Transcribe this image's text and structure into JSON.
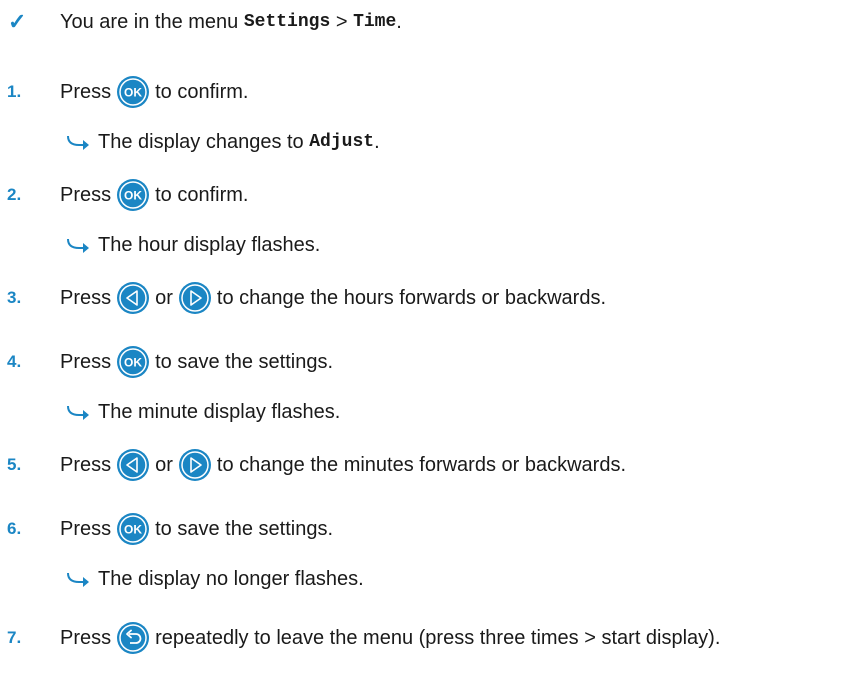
{
  "precondition": {
    "prefix": "You are in the menu ",
    "menu1": "Settings",
    "separator": " > ",
    "menu2": "Time",
    "suffix": "."
  },
  "steps": [
    {
      "num": "1.",
      "pre": "Press",
      "post": "to confirm.",
      "result_pre": "The display changes to ",
      "result_code": "Adjust",
      "result_post": "."
    },
    {
      "num": "2.",
      "pre": "Press",
      "post": "to confirm.",
      "result": "The hour display flashes."
    },
    {
      "num": "3.",
      "pre": "Press",
      "mid": "or",
      "post": "to change the hours forwards or backwards."
    },
    {
      "num": "4.",
      "pre": "Press",
      "post": "to save the settings.",
      "result": "The minute display flashes."
    },
    {
      "num": "5.",
      "pre": "Press",
      "mid": "or",
      "post": "to change the minutes forwards or backwards."
    },
    {
      "num": "6.",
      "pre": "Press",
      "post": "to save the settings.",
      "result": "The display no longer flashes."
    },
    {
      "num": "7.",
      "pre": "Press",
      "post": "repeatedly to leave the menu (press three times > start display)."
    }
  ],
  "icons": {
    "ok_label": "OK",
    "accent_color": "#1b86c4"
  }
}
